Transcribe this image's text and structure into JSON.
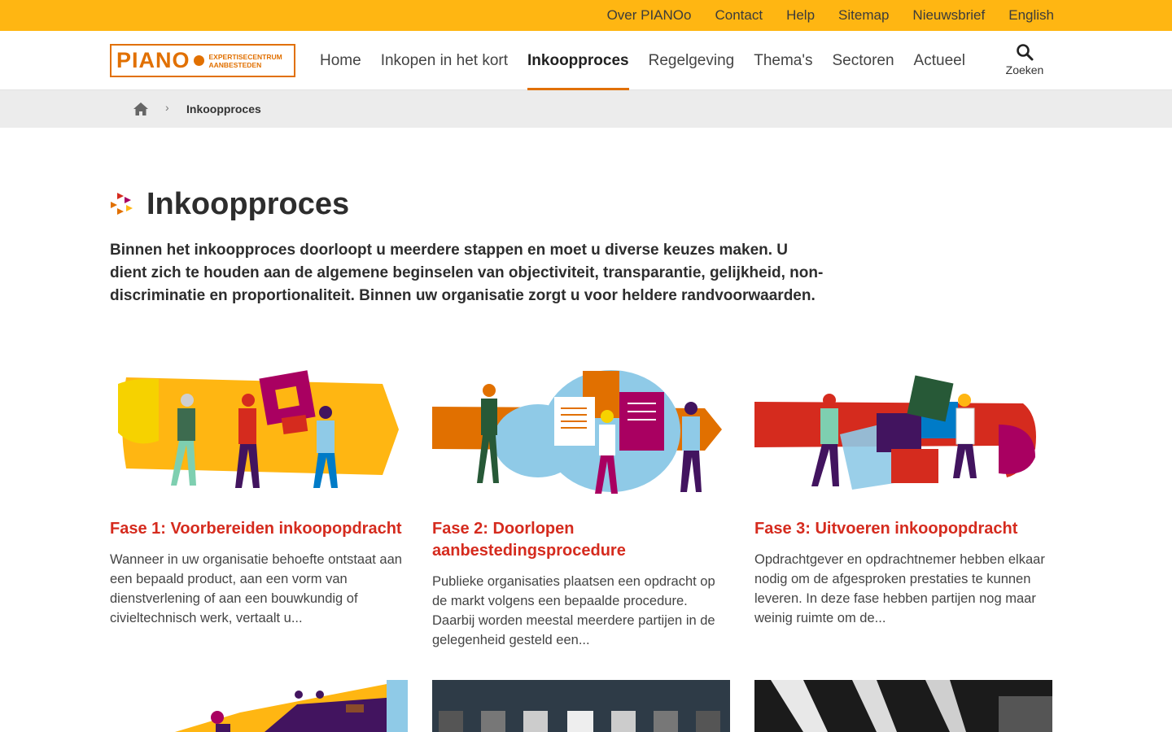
{
  "topbar": {
    "links": [
      "Over PIANOo",
      "Contact",
      "Help",
      "Sitemap",
      "Nieuwsbrief",
      "English"
    ]
  },
  "logo": {
    "word": "PIANO",
    "line1": "EXPERTISECENTRUM",
    "line2": "AANBESTEDEN"
  },
  "nav": {
    "items": [
      "Home",
      "Inkopen in het kort",
      "Inkoopproces",
      "Regelgeving",
      "Thema's",
      "Sectoren",
      "Actueel"
    ],
    "active": "Inkoopproces",
    "search_label": "Zoeken"
  },
  "breadcrumb": {
    "current": "Inkoopproces"
  },
  "page": {
    "title": "Inkoopproces",
    "intro": "Binnen het inkoopproces doorloopt u meerdere stappen en moet u diverse keuzes maken. U dient zich te houden aan de algemene beginselen van objectiviteit, transparantie, gelijkheid, non-discriminatie en proportionaliteit. Binnen uw organisatie zorgt u voor heldere randvoorwaarden."
  },
  "cards": [
    {
      "title": "Fase 1: Voorbereiden inkoopopdracht",
      "text": "Wanneer in uw organisatie behoefte ontstaat aan een bepaald product, aan een vorm van dienstverlening of aan een bouwkundig of civieltechnisch werk, vertaalt u..."
    },
    {
      "title": "Fase 2: Doorlopen aanbestedingsprocedure",
      "text": "Publieke organisaties plaatsen een opdracht op de markt volgens een bepaalde procedure. Daarbij worden meestal meerdere partijen in de gelegenheid gesteld een..."
    },
    {
      "title": "Fase 3: Uitvoeren inkoopopdracht",
      "text": "Opdrachtgever en opdrachtnemer hebben elkaar nodig om de afgesproken prestaties te kunnen leveren. In deze fase hebben partijen nog maar weinig ruimte om de..."
    }
  ],
  "colors": {
    "topbar": "#ffb612",
    "accent": "#e17000",
    "card_title": "#d52b1e"
  },
  "icons": {
    "search": "search-icon",
    "home": "home-icon",
    "chevron": "chevron-right-icon"
  }
}
